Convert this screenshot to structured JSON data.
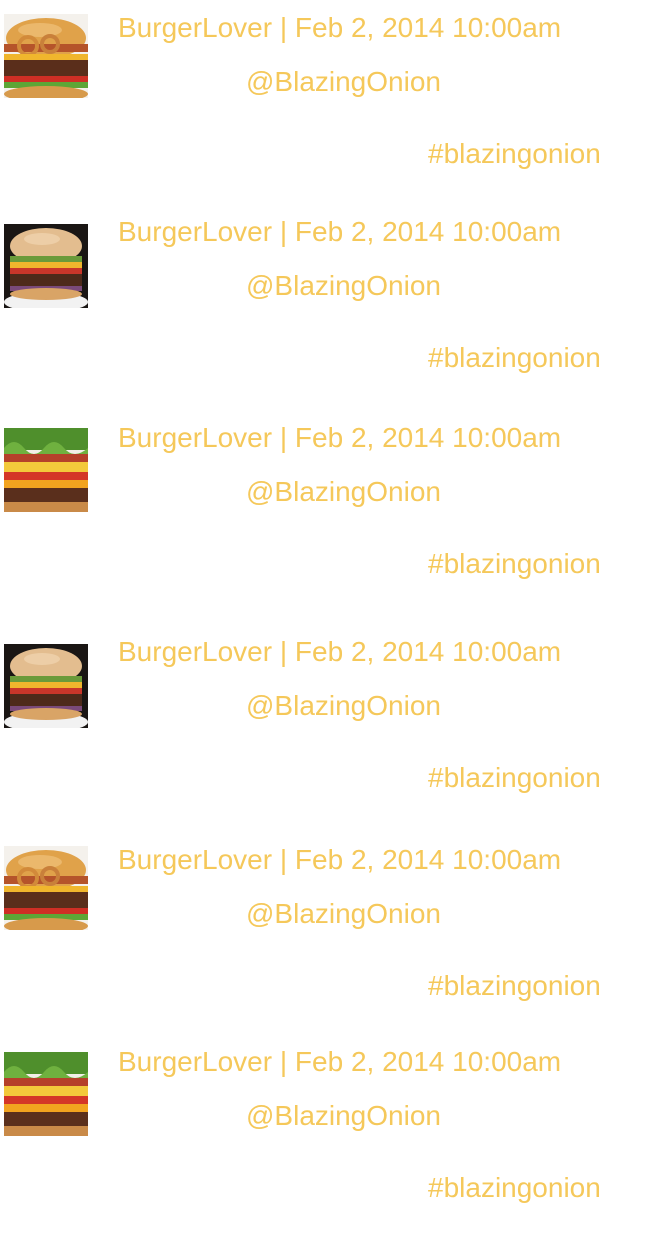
{
  "accent_color": "#f5c85a",
  "posts": [
    {
      "avatar_icon": "bacon-onion-burger-photo",
      "author": "BurgerLover",
      "separator": "|",
      "date": "Feb 2, 2014 10:00am",
      "meta": "BurgerLover | Feb 2, 2014 10:00am",
      "handle": "@BlazingOnion",
      "hashtag": "#blazingonion"
    },
    {
      "avatar_icon": "cheeseburger-on-plate-photo",
      "author": "BurgerLover",
      "separator": "|",
      "date": "Feb 2, 2014 10:00am",
      "meta": "BurgerLover | Feb 2, 2014 10:00am",
      "handle": "@BlazingOnion",
      "hashtag": "#blazingonion"
    },
    {
      "avatar_icon": "lettuce-cheese-burger-photo",
      "author": "BurgerLover",
      "separator": "|",
      "date": "Feb 2, 2014 10:00am",
      "meta": "BurgerLover | Feb 2, 2014 10:00am",
      "handle": "@BlazingOnion",
      "hashtag": "#blazingonion"
    },
    {
      "avatar_icon": "cheeseburger-on-plate-photo",
      "author": "BurgerLover",
      "separator": "|",
      "date": "Feb 2, 2014 10:00am",
      "meta": "BurgerLover | Feb 2, 2014 10:00am",
      "handle": "@BlazingOnion",
      "hashtag": "#blazingonion"
    },
    {
      "avatar_icon": "bacon-onion-burger-photo",
      "author": "BurgerLover",
      "separator": "|",
      "date": "Feb 2, 2014 10:00am",
      "meta": "BurgerLover | Feb 2, 2014 10:00am",
      "handle": "@BlazingOnion",
      "hashtag": "#blazingonion"
    },
    {
      "avatar_icon": "lettuce-cheese-burger-photo",
      "author": "BurgerLover",
      "separator": "|",
      "date": "Feb 2, 2014 10:00am",
      "meta": "BurgerLover | Feb 2, 2014 10:00am",
      "handle": "@BlazingOnion",
      "hashtag": "#blazingonion"
    }
  ]
}
